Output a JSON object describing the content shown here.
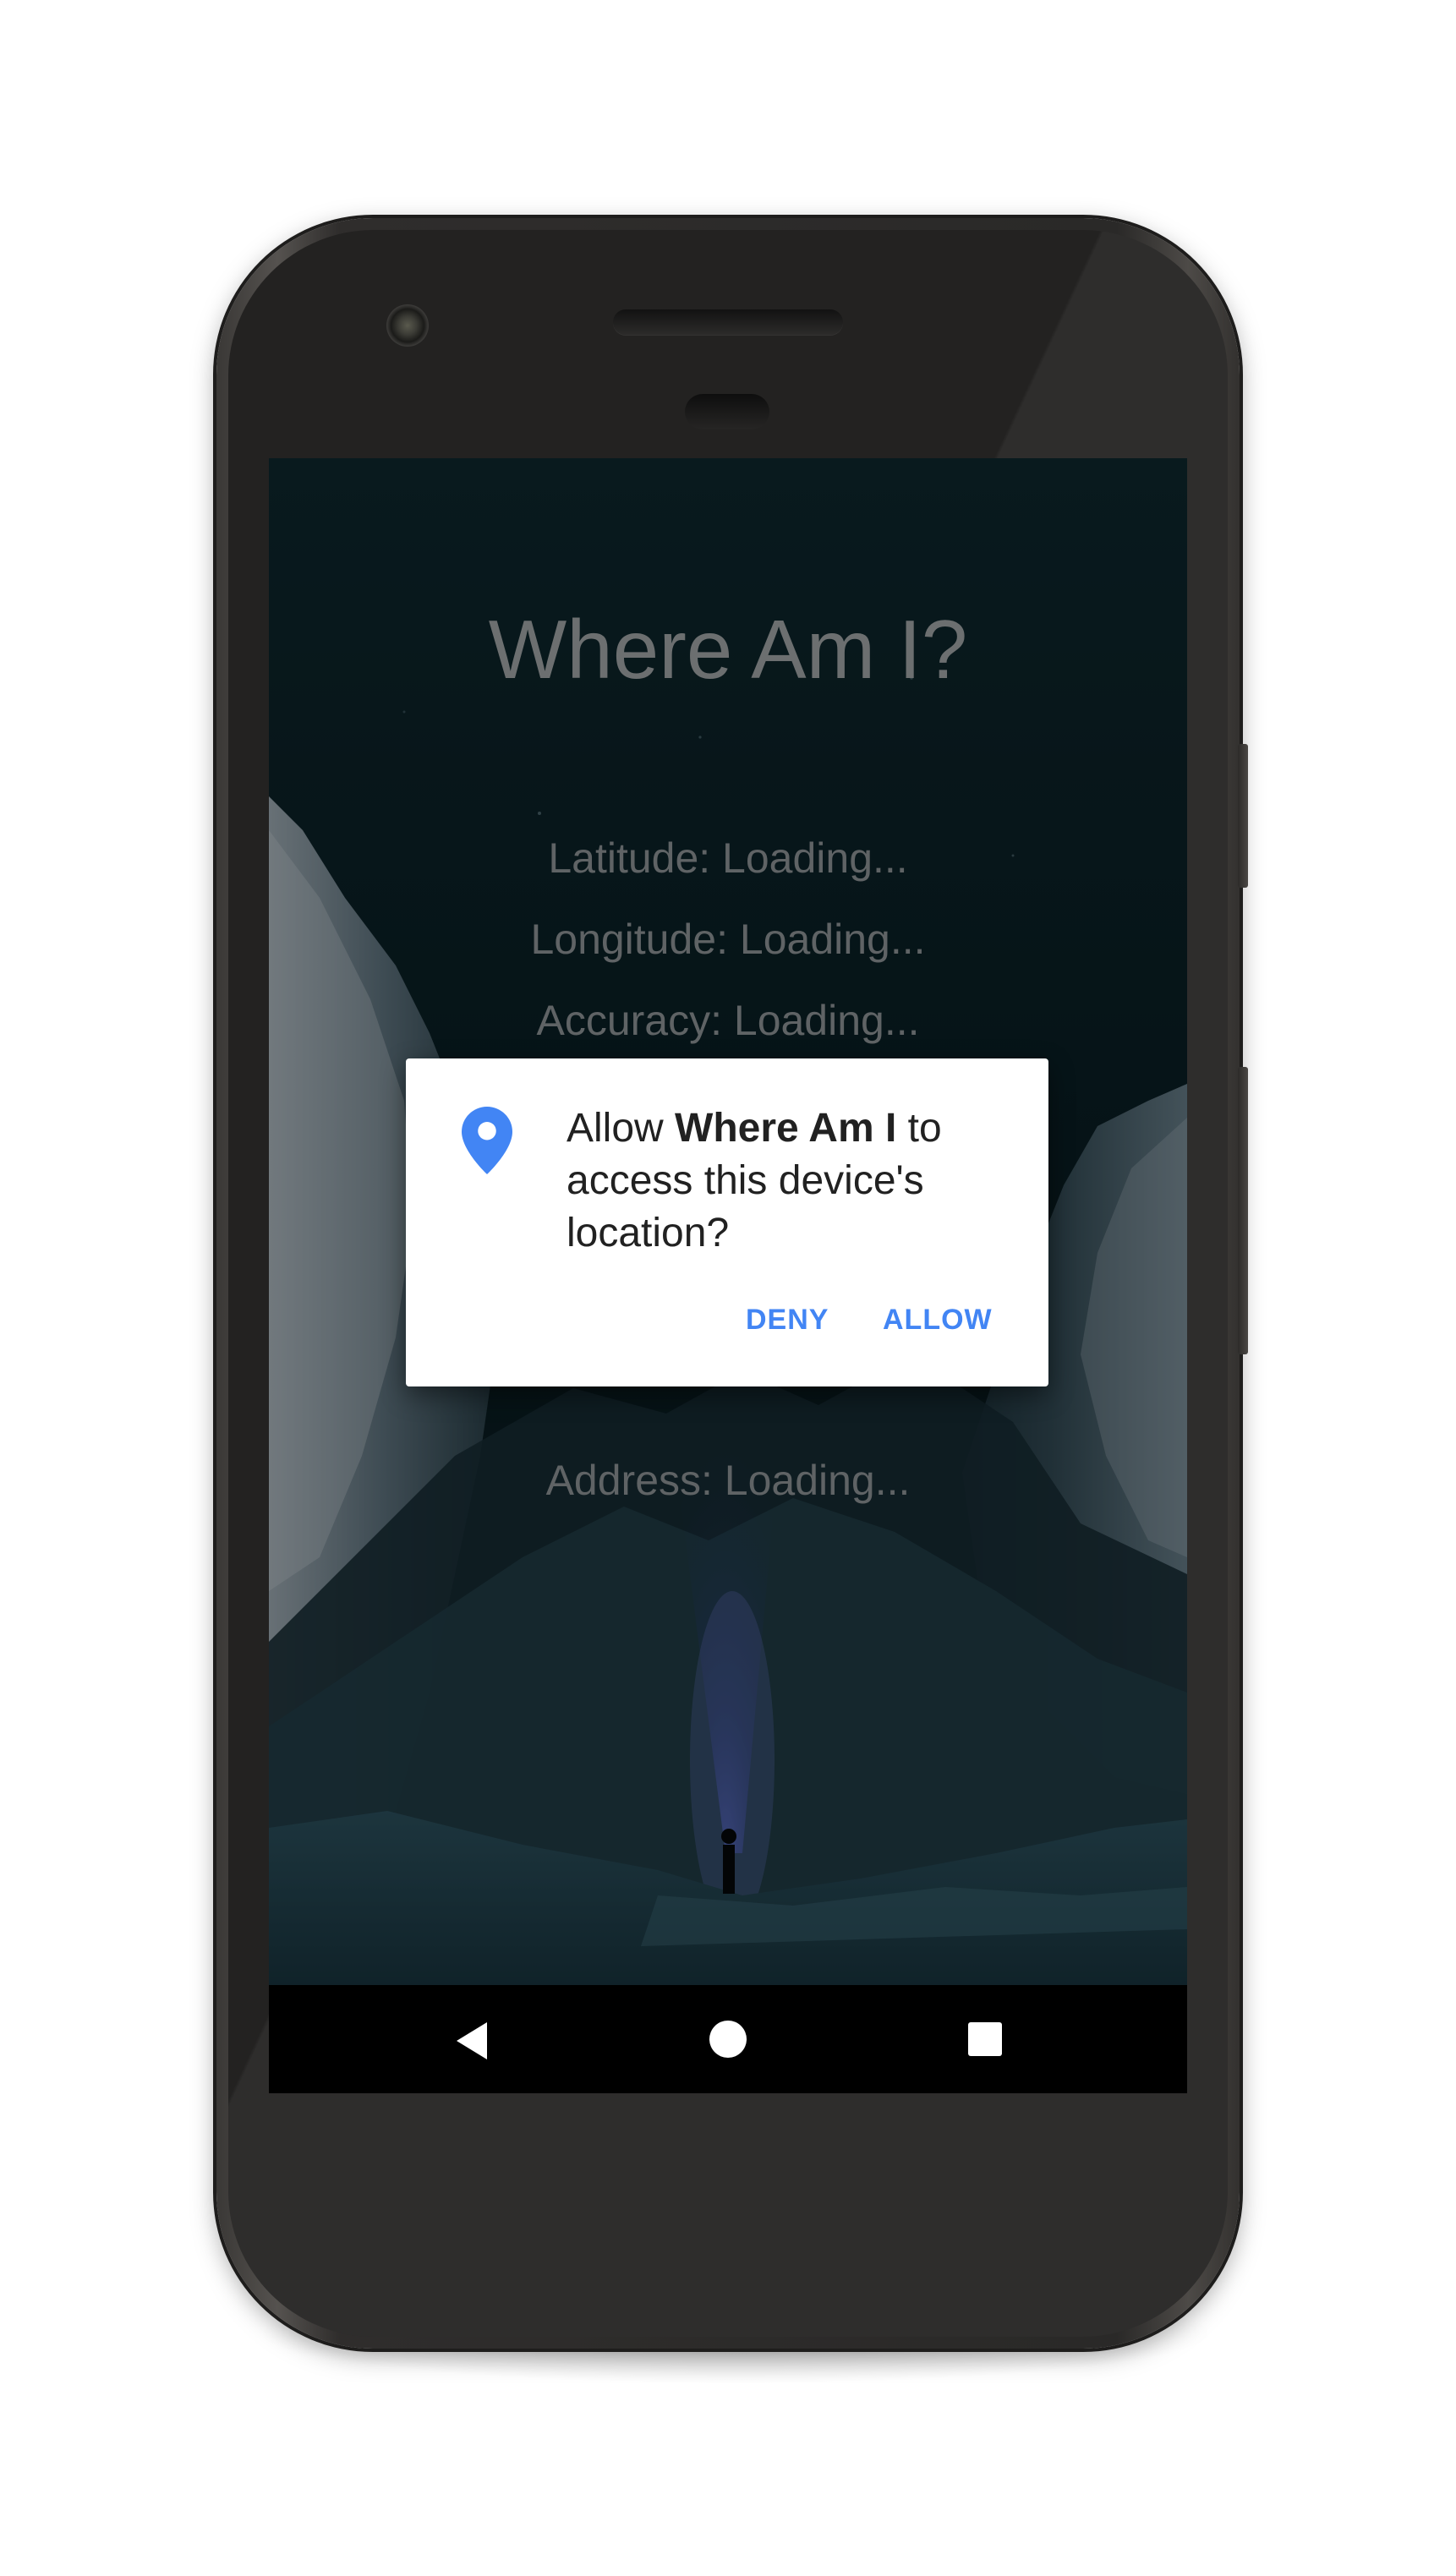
{
  "app": {
    "title": "Where Am I?",
    "latitude_line": "Latitude: Loading...",
    "longitude_line": "Longitude: Loading...",
    "accuracy_line": "Accuracy: Loading...",
    "address_line": "Address: Loading..."
  },
  "permission_dialog": {
    "icon": "location-pin-icon",
    "message_prefix": "Allow ",
    "app_name": "Where Am I",
    "message_suffix": " to access this device's location?",
    "deny_label": "DENY",
    "allow_label": "ALLOW",
    "accent_color": "#4285f4"
  },
  "navigation_bar": {
    "back_icon": "back-triangle-icon",
    "home_icon": "home-circle-icon",
    "recents_icon": "recents-square-icon"
  }
}
